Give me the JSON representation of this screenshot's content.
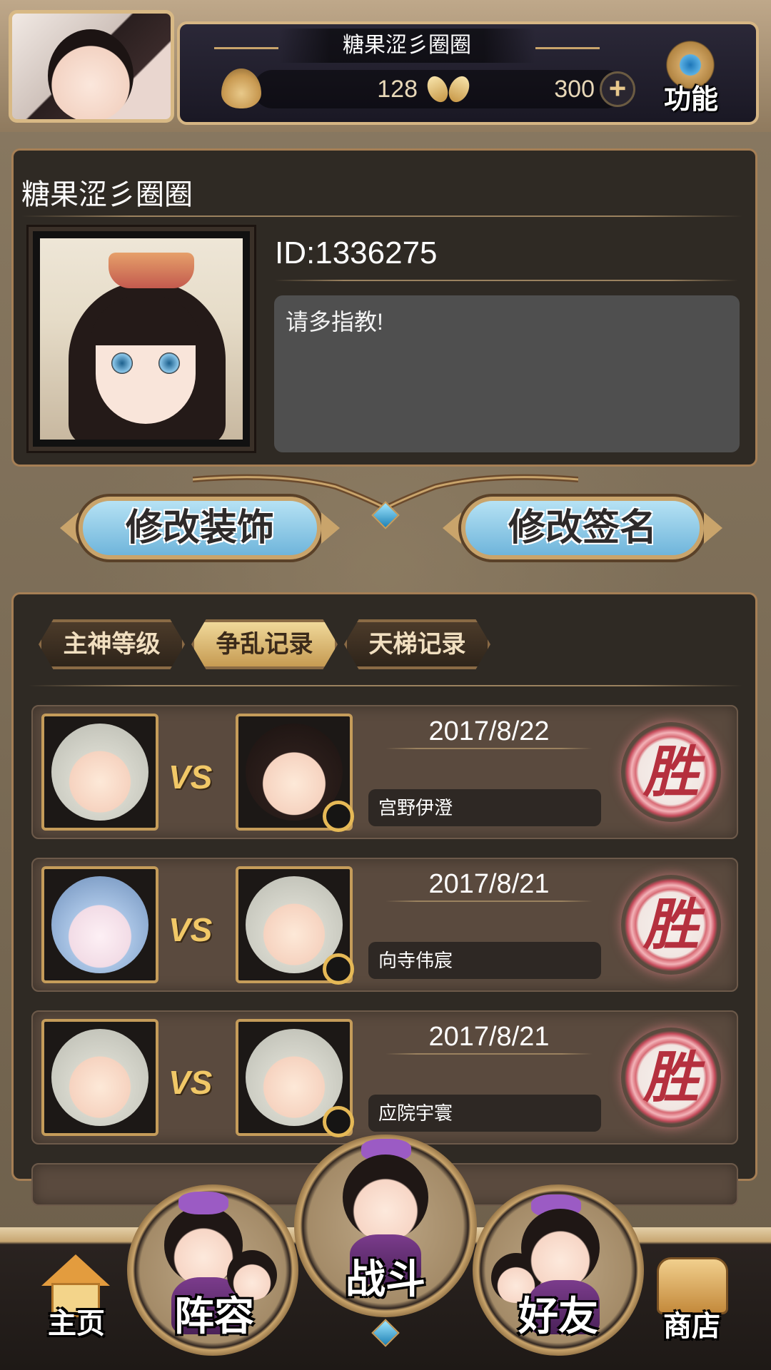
{
  "header": {
    "player_name": "糖果涩彡圈圈",
    "resource_a": "128",
    "resource_b": "300",
    "function_label": "功能"
  },
  "profile": {
    "name": "糖果涩彡圈圈",
    "id": "ID:1336275",
    "signature": "请多指教!"
  },
  "actions": {
    "edit_decoration": "修改装饰",
    "edit_signature": "修改签名"
  },
  "tabs": [
    {
      "label": "主神等级",
      "active": false
    },
    {
      "label": "争乱记录",
      "active": true
    },
    {
      "label": "天梯记录",
      "active": false
    }
  ],
  "records": [
    {
      "vs": "VS",
      "date": "2017/8/22",
      "opponent": "宫野伊澄",
      "result": "胜"
    },
    {
      "vs": "VS",
      "date": "2017/8/21",
      "opponent": "向寺伟宸",
      "result": "胜"
    },
    {
      "vs": "VS",
      "date": "2017/8/21",
      "opponent": "应院宇寰",
      "result": "胜"
    }
  ],
  "nav": {
    "home": "主页",
    "lineup": "阵容",
    "battle": "战斗",
    "friends": "好友",
    "shop": "商店"
  },
  "icons": {
    "resource_a": "flame-icon",
    "resource_b": "butterfly-icon",
    "add": "plus-icon",
    "settings": "gear-icon",
    "inspect": "magnifier-icon",
    "home": "house-icon",
    "shop": "chest-icon"
  },
  "colors": {
    "accent_gold": "#c9a46b",
    "button_blue": "#6fb5db",
    "win_red": "#b5303e",
    "panel_dark": "#2f2a24"
  }
}
